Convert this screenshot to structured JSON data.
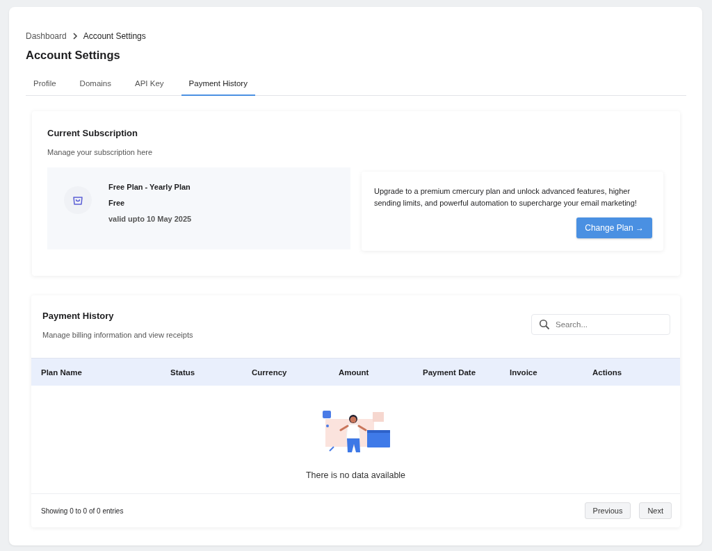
{
  "breadcrumb": [
    {
      "label": "Dashboard"
    },
    {
      "label": "Account Settings"
    }
  ],
  "title": "Account Settings",
  "tabs": [
    {
      "label": "Profile",
      "selected": false
    },
    {
      "label": "Domains",
      "selected": false
    },
    {
      "label": "API Key",
      "selected": false
    },
    {
      "label": "Payment History",
      "selected": true
    }
  ],
  "subscription": {
    "title": "Current Subscription",
    "subtitle": "Manage your subscription here",
    "plan_name": "Free Plan - Yearly Plan",
    "price": "Free",
    "validity": "valid upto 10 May 2025",
    "upgrade_text": "Upgrade to a premium cmercury plan and unlock advanced features, higher sending limits, and powerful automation to supercharge your email marketing!",
    "button": "Change Plan →"
  },
  "payment_history": {
    "title": "Payment History",
    "subtitle": "Manage billing information and view receipts",
    "search": {
      "placeholder": "Search..."
    },
    "table": {
      "columns": [
        "Plan Name",
        "Status",
        "Currency",
        "Amount",
        "Payment Date",
        "Invoice",
        "Actions"
      ]
    },
    "empty_message": "There is no data available",
    "footer": "Showing 0 to 0 of 0 entries",
    "buttons": [
      "Previous",
      "Next"
    ]
  }
}
